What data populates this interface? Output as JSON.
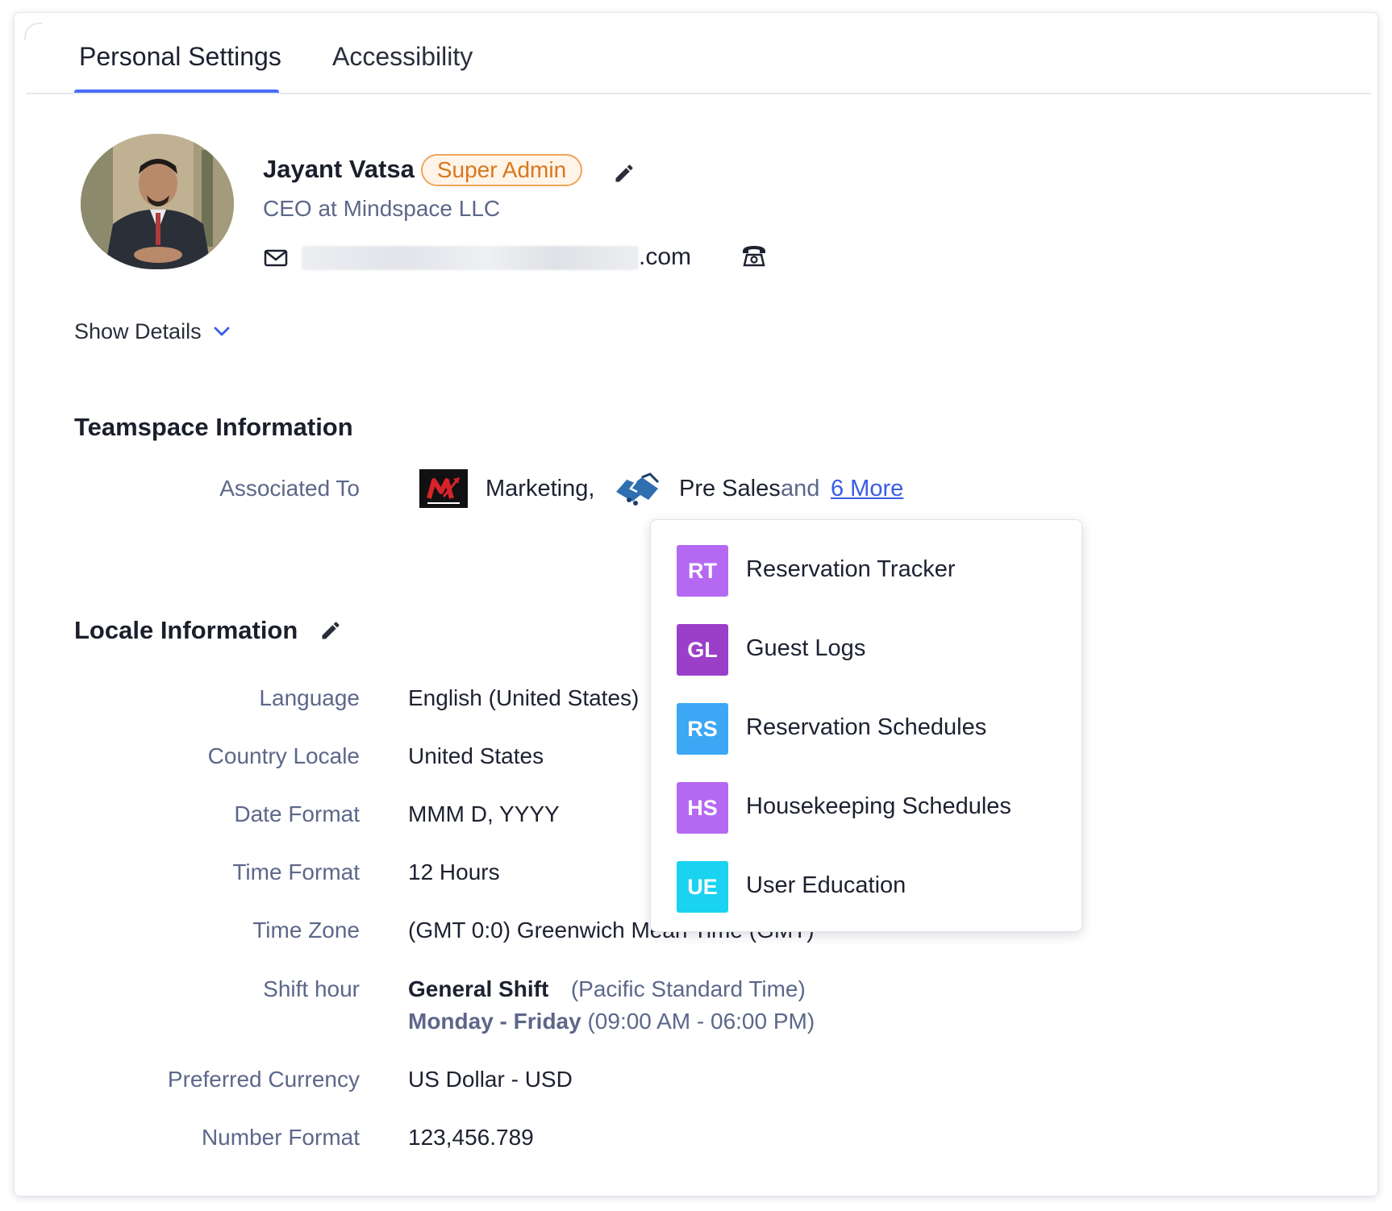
{
  "tabs": [
    {
      "label": "Personal Settings",
      "active": true
    },
    {
      "label": "Accessibility",
      "active": false
    }
  ],
  "profile": {
    "name": "Jayant Vatsa",
    "role_badge": "Super Admin",
    "title": "CEO  at  Mindspace LLC",
    "email_domain": ".com",
    "show_details": "Show Details"
  },
  "teamspace": {
    "title": "Teamspace Information",
    "associated_label": "Associated To",
    "team1": "Marketing,",
    "team2": "Pre Sales",
    "and": "and",
    "more_link": "6 More"
  },
  "locale": {
    "title": "Locale Information",
    "rows": [
      {
        "label": "Language",
        "value": "English (United States)"
      },
      {
        "label": "Country Locale",
        "value": "United States"
      },
      {
        "label": "Date Format",
        "value": "MMM D, YYYY"
      },
      {
        "label": "Time Format",
        "value": "12 Hours"
      },
      {
        "label": "Time Zone",
        "value": "(GMT 0:0) Greenwich Mean Time (GMT)"
      },
      {
        "label": "Shift hour",
        "value": ""
      },
      {
        "label": "Preferred Currency",
        "value": "US Dollar - USD"
      },
      {
        "label": "Number Format",
        "value": "123,456.789"
      }
    ],
    "shift": {
      "name": "General Shift",
      "zone": "(Pacific Standard Time)",
      "days": "Monday - Friday",
      "hours": "(09:00 AM - 06:00 PM)"
    }
  },
  "dropdown": {
    "items": [
      {
        "initials": "RT",
        "label": "Reservation Tracker",
        "color": "#b569f2"
      },
      {
        "initials": "GL",
        "label": "Guest Logs",
        "color": "#9b3fc9"
      },
      {
        "initials": "RS",
        "label": "Reservation Schedules",
        "color": "#3ba7f5"
      },
      {
        "initials": "HS",
        "label": "Housekeeping Schedules",
        "color": "#b569f2"
      },
      {
        "initials": "UE",
        "label": "User Education",
        "color": "#19d3f0"
      }
    ]
  },
  "colors": {
    "accent": "#4a6cf7",
    "link": "#3a5ce6",
    "badge_text": "#d9771c",
    "badge_border": "#f0a55a",
    "muted": "#5c6789"
  }
}
